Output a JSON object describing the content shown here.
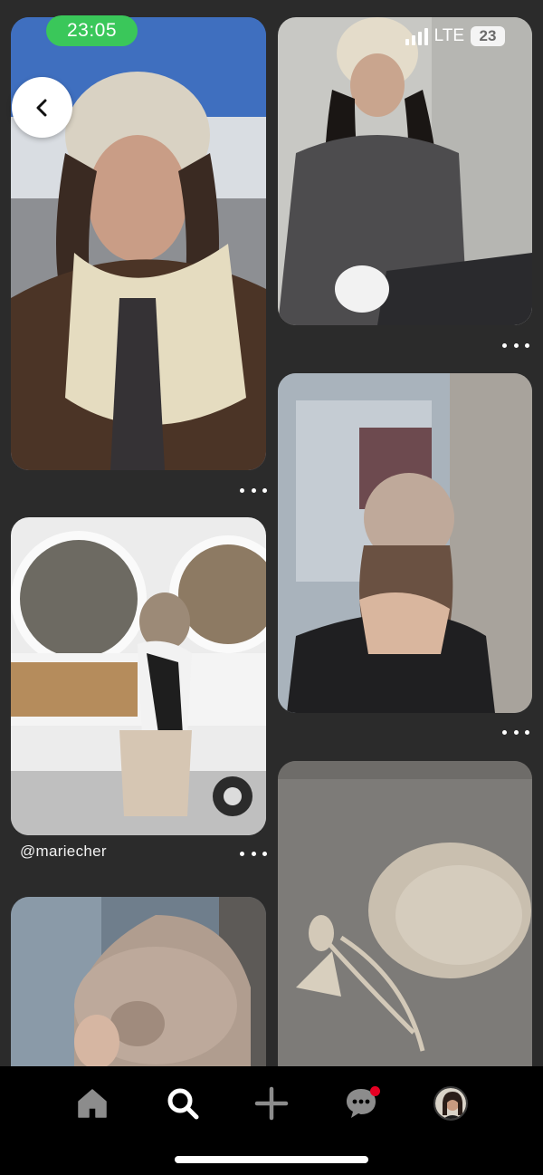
{
  "status_bar": {
    "time": "23:05",
    "network": "LTE",
    "battery": "23"
  },
  "pins": [
    {
      "id": "pin-1",
      "subject": "woman in crochet bonnet and shearling jacket"
    },
    {
      "id": "pin-2",
      "subject": "woman in crochet hood with white bag"
    },
    {
      "id": "pin-3",
      "subject": "woman in crochet beanie at window"
    },
    {
      "id": "pin-4",
      "subject": "girl in knit beanie at coffee truck",
      "author": "@mariecher"
    },
    {
      "id": "pin-5",
      "subject": "crochet bonnet on pavement"
    },
    {
      "id": "pin-6",
      "subject": "crochet flower beanie close-up"
    }
  ],
  "icons": {
    "back": "chevron-left-icon",
    "more": "more-dots-icon",
    "home": "home-icon",
    "search": "search-icon",
    "create": "plus-icon",
    "messages": "chat-bubble-icon",
    "profile": "avatar"
  },
  "colors": {
    "background": "#2b2b2b",
    "nav_background": "#000000",
    "time_pill": "#3ac75a",
    "notification_dot": "#e60023"
  }
}
